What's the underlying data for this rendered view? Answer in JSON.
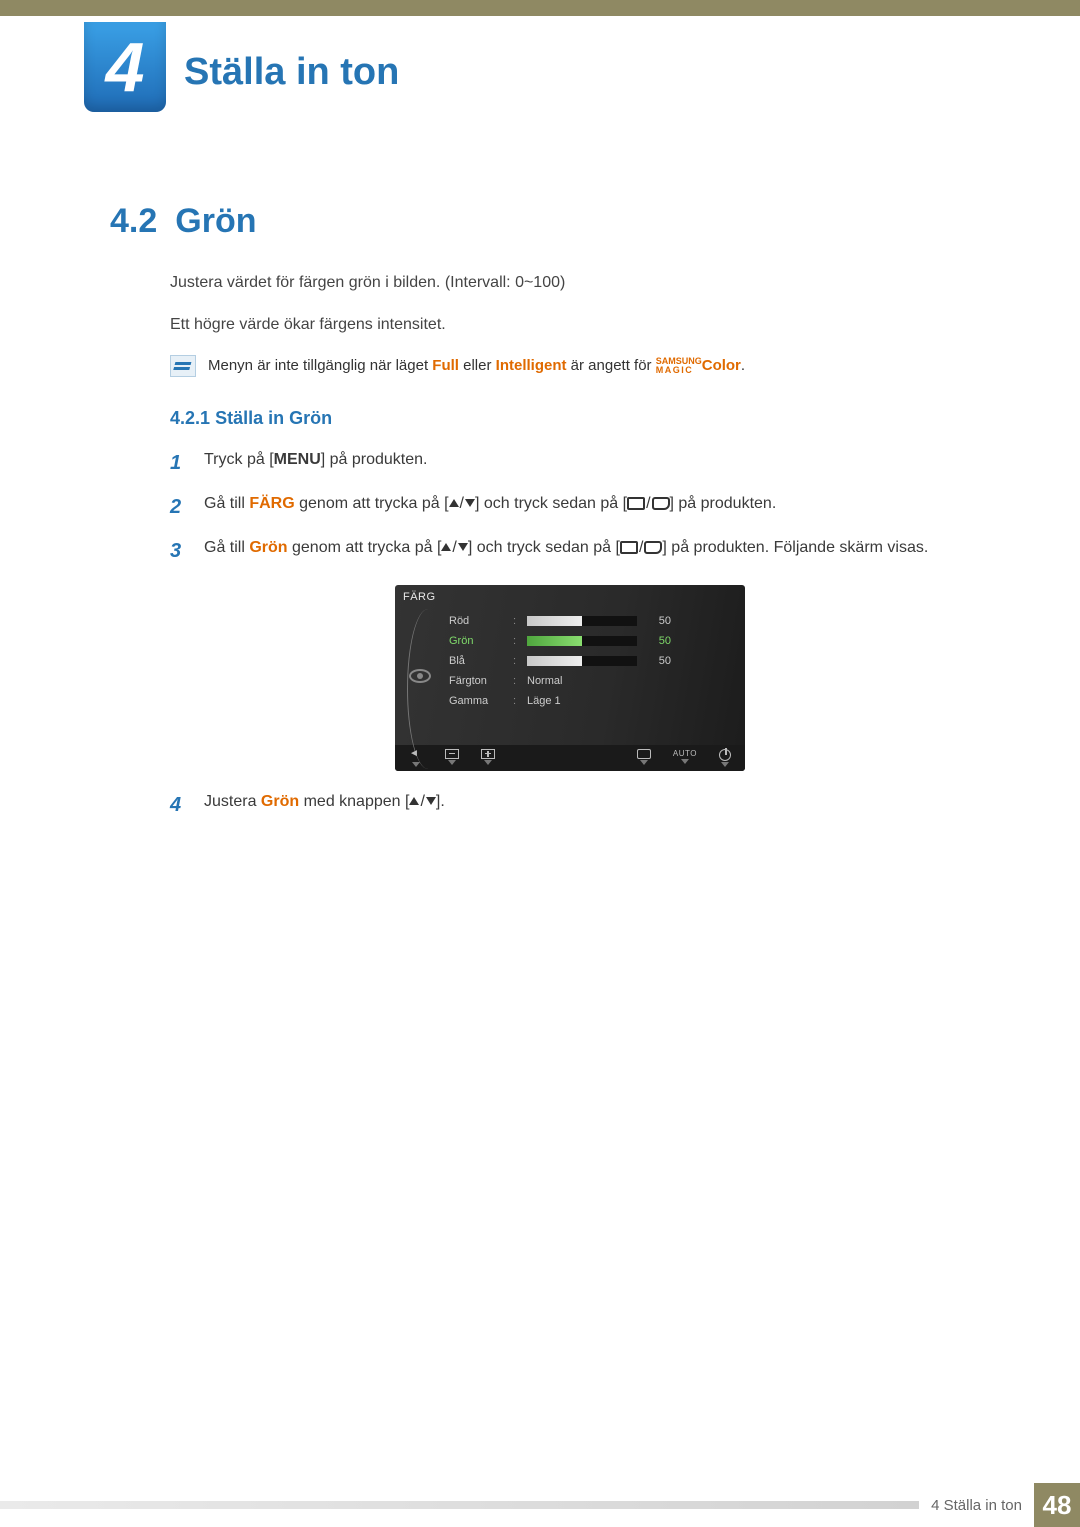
{
  "header": {
    "chapter_number": "4",
    "chapter_title": "Ställa in ton"
  },
  "section": {
    "number": "4.2",
    "title": "Grön",
    "body_p1": "Justera värdet för färgen grön i bilden. (Intervall: 0~100)",
    "body_p2": "Ett högre värde ökar färgens intensitet."
  },
  "note": {
    "pre": "Menyn är inte tillgänglig när läget ",
    "full": "Full",
    "mid1": " eller ",
    "intelligent": "Intelligent",
    "mid2": " är angett för ",
    "magic_top": "SAMSUNG",
    "magic_bot": "MAGIC",
    "color": "Color",
    "end": "."
  },
  "subsection": {
    "number": "4.2.1",
    "title": "Ställa in Grön"
  },
  "steps": {
    "s1": {
      "num": "1",
      "pre": "Tryck på [",
      "menu": "MENU",
      "post": "] på produkten."
    },
    "s2": {
      "num": "2",
      "pre": "Gå till ",
      "farg": "FÄRG",
      "mid": " genom att trycka på [",
      "mid2": "] och tryck sedan på [",
      "post": "] på produkten."
    },
    "s3": {
      "num": "3",
      "pre": "Gå till ",
      "gron": "Grön",
      "mid": " genom att trycka på [",
      "mid2": "] och tryck sedan på [",
      "post": "] på produkten. Följande skärm visas."
    },
    "s4": {
      "num": "4",
      "pre": "Justera ",
      "gron": "Grön",
      "mid": " med knappen [",
      "post": "]."
    }
  },
  "osd": {
    "title": "FÄRG",
    "rows": [
      {
        "label": "Röd",
        "value": 50,
        "pct": 50,
        "active": false,
        "type": "bar"
      },
      {
        "label": "Grön",
        "value": 50,
        "pct": 50,
        "active": true,
        "type": "bar"
      },
      {
        "label": "Blå",
        "value": 50,
        "pct": 50,
        "active": false,
        "type": "bar"
      },
      {
        "label": "Färgton",
        "text": "Normal",
        "type": "text"
      },
      {
        "label": "Gamma",
        "text": "Läge 1",
        "type": "text"
      }
    ],
    "auto_label": "AUTO"
  },
  "footer": {
    "text": "4 Ställa in ton",
    "page": "48"
  }
}
